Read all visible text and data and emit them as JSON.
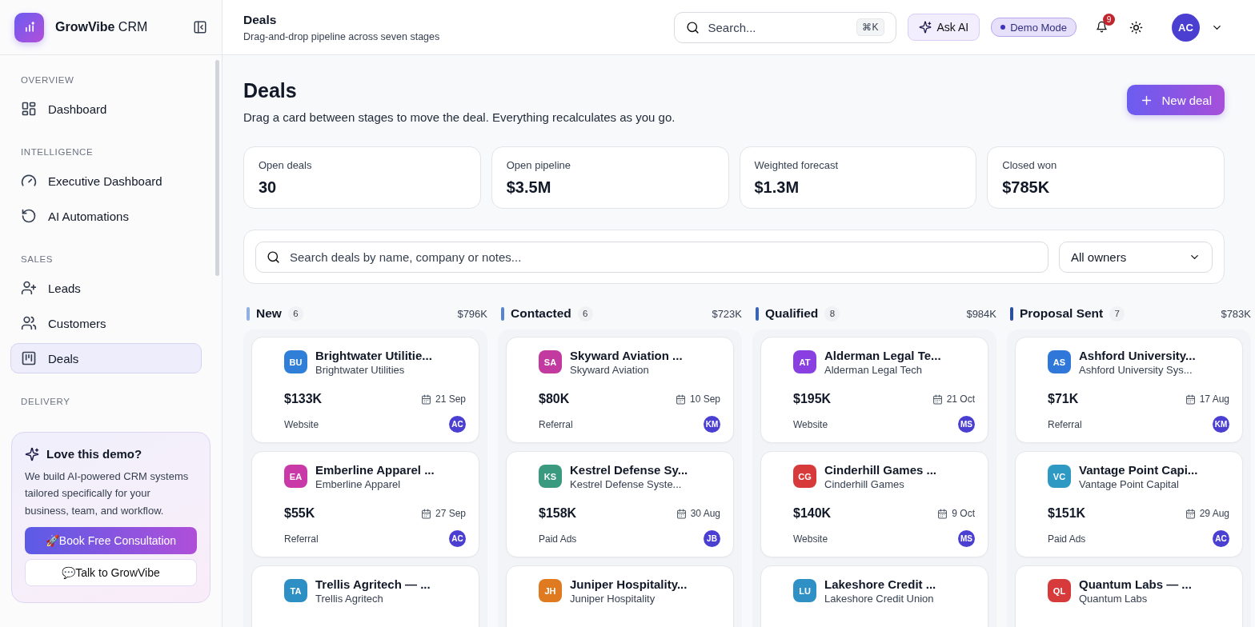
{
  "sidebar": {
    "brand": "**GrowVibe** CRM",
    "sections": [
      {
        "label": "OVERVIEW",
        "items": [
          {
            "label": "Dashboard",
            "selected": false
          }
        ]
      },
      {
        "label": "INTELLIGENCE",
        "items": [
          {
            "label": "Executive Dashboard",
            "selected": false
          },
          {
            "label": "AI Automations",
            "selected": false
          }
        ]
      },
      {
        "label": "SALES",
        "items": [
          {
            "label": "Leads",
            "selected": false
          },
          {
            "label": "Customers",
            "selected": false
          },
          {
            "label": "Deals",
            "selected": true
          }
        ]
      },
      {
        "label": "DELIVERY"
      }
    ],
    "promo": {
      "title": "Love this demo?",
      "text": "We build AI-powered CRM systems tailored specifically for your business, team, and workflow.",
      "primary": "🚀Book Free Consultation",
      "secondary": "💬Talk to GrowVibe"
    }
  },
  "header": {
    "title": "Deals",
    "subtitle": "Drag-and-drop pipeline across seven stages",
    "search": {
      "placeholder": "Search...",
      "shortcut": "⌘K"
    },
    "ask_ai": "Ask AI",
    "mode_badge": "Demo Mode",
    "notifications": "9",
    "user": "AC"
  },
  "page": {
    "title": "Deals",
    "description": "Drag a card between stages to move the deal. Everything recalculates as you go.",
    "new_button": "New deal"
  },
  "kpis": [
    {
      "label": "Open deals",
      "value": "30"
    },
    {
      "label": "Open pipeline",
      "value": "$3.5M"
    },
    {
      "label": "Weighted forecast",
      "value": "$1.3M"
    },
    {
      "label": "Closed won",
      "value": "$785K"
    }
  ],
  "filters": {
    "search": {
      "placeholder": "Search deals by name, company or notes..."
    },
    "owner": "All owners"
  },
  "stages": [
    {
      "name": "New",
      "count": "6",
      "total": "$796K",
      "color": "#8fb0e0",
      "deals": [
        {
          "initials": "BU",
          "color": "#2f7fd9",
          "title": "Brightwater Utilitie...",
          "company": "Brightwater Utilities",
          "amount": "$133K",
          "date": "21 Sep",
          "source": "Website",
          "owner": "AC"
        },
        {
          "initials": "EA",
          "color": "#c93aa8",
          "title": "Emberline Apparel ...",
          "company": "Emberline Apparel",
          "amount": "$55K",
          "date": "27 Sep",
          "source": "Referral",
          "owner": "AC"
        },
        {
          "initials": "TA",
          "color": "#2e8fc4",
          "title": "Trellis Agritech — ...",
          "company": "Trellis Agritech"
        }
      ]
    },
    {
      "name": "Contacted",
      "count": "6",
      "total": "$723K",
      "color": "#5b85c9",
      "deals": [
        {
          "initials": "SA",
          "color": "#c23aa0",
          "title": "Skyward Aviation ...",
          "company": "Skyward Aviation",
          "amount": "$80K",
          "date": "10 Sep",
          "source": "Referral",
          "owner": "KM"
        },
        {
          "initials": "KS",
          "color": "#3a9a80",
          "title": "Kestrel Defense Sy...",
          "company": "Kestrel Defense Syste...",
          "amount": "$158K",
          "date": "30 Aug",
          "source": "Paid Ads",
          "owner": "JB"
        },
        {
          "initials": "JH",
          "color": "#e07a20",
          "title": "Juniper Hospitality...",
          "company": "Juniper Hospitality"
        }
      ]
    },
    {
      "name": "Qualified",
      "count": "8",
      "total": "$984K",
      "color": "#3a65b5",
      "deals": [
        {
          "initials": "AT",
          "color": "#8a3fe0",
          "title": "Alderman Legal Te...",
          "company": "Alderman Legal Tech",
          "amount": "$195K",
          "date": "21 Oct",
          "source": "Website",
          "owner": "MS"
        },
        {
          "initials": "CG",
          "color": "#d63a3a",
          "title": "Cinderhill Games ...",
          "company": "Cinderhill Games",
          "amount": "$140K",
          "date": "9 Oct",
          "source": "Website",
          "owner": "MS"
        },
        {
          "initials": "LU",
          "color": "#2e90c4",
          "title": "Lakeshore Credit ...",
          "company": "Lakeshore Credit Union"
        }
      ]
    },
    {
      "name": "Proposal Sent",
      "count": "7",
      "total": "$783K",
      "color": "#2a4f9e",
      "deals": [
        {
          "initials": "AS",
          "color": "#2f78d9",
          "title": "Ashford University...",
          "company": "Ashford University Sys...",
          "amount": "$71K",
          "date": "17 Aug",
          "source": "Referral",
          "owner": "KM"
        },
        {
          "initials": "VC",
          "color": "#2e9ac4",
          "title": "Vantage Point Capi...",
          "company": "Vantage Point Capital",
          "amount": "$151K",
          "date": "29 Aug",
          "source": "Paid Ads",
          "owner": "AC"
        },
        {
          "initials": "QL",
          "color": "#d63a3a",
          "title": "Quantum Labs — ...",
          "company": "Quantum Labs"
        }
      ]
    }
  ]
}
